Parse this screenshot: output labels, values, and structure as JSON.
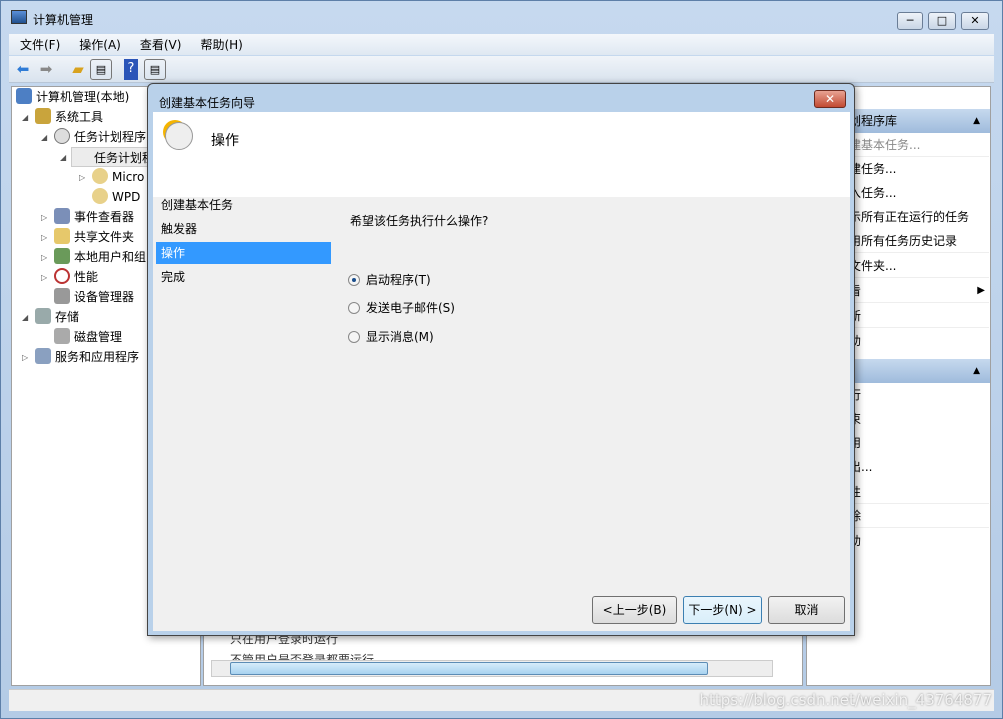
{
  "window": {
    "title": "计算机管理",
    "min": "─",
    "max": "□",
    "close": "✕"
  },
  "menu": [
    "文件(F)",
    "操作(A)",
    "查看(V)",
    "帮助(H)"
  ],
  "tree": [
    {
      "label": "计算机管理(本地)",
      "level": 0,
      "expander": ""
    },
    {
      "label": "系统工具",
      "level": 1,
      "expander": "◢"
    },
    {
      "label": "任务计划程序",
      "level": 2,
      "expander": "◢"
    },
    {
      "label": "任务计划程",
      "level": 3,
      "expander": "◢"
    },
    {
      "label": "Micro",
      "level": 4,
      "expander": "▷"
    },
    {
      "label": "WPD",
      "level": 4,
      "expander": ""
    },
    {
      "label": "事件查看器",
      "level": 2,
      "expander": "▷"
    },
    {
      "label": "共享文件夹",
      "level": 2,
      "expander": "▷"
    },
    {
      "label": "本地用户和组",
      "level": 2,
      "expander": "▷"
    },
    {
      "label": "性能",
      "level": 2,
      "expander": "▷"
    },
    {
      "label": "设备管理器",
      "level": 2,
      "expander": ""
    },
    {
      "label": "存储",
      "level": 1,
      "expander": "◢"
    },
    {
      "label": "磁盘管理",
      "level": 2,
      "expander": ""
    },
    {
      "label": "服务和应用程序",
      "level": 1,
      "expander": "▷"
    }
  ],
  "middle": {
    "radio1": "只在用户登录时运行",
    "radio2": "不管用户是否登录都要运行"
  },
  "actions": {
    "header1": "划程序库",
    "group1": [
      {
        "label": "建基本任务...",
        "disabled": true
      },
      {
        "label": "建任务..."
      },
      {
        "label": "入任务..."
      },
      {
        "label": "示所有正在运行的任务"
      },
      {
        "label": "用所有任务历史记录"
      },
      {
        "label": "文件夹..."
      },
      {
        "label": "看",
        "submenu": true
      },
      {
        "label": "新"
      },
      {
        "label": "助"
      }
    ],
    "group2": [
      {
        "label": "行"
      },
      {
        "label": "束"
      },
      {
        "label": "用"
      },
      {
        "label": "出..."
      },
      {
        "label": "性"
      },
      {
        "label": "除"
      },
      {
        "label": "助"
      }
    ]
  },
  "dialog": {
    "title": "创建基本任务向导",
    "close": "✕",
    "heading": "操作",
    "steps": [
      {
        "label": "创建基本任务"
      },
      {
        "label": "触发器"
      },
      {
        "label": "操作",
        "selected": true
      },
      {
        "label": "完成"
      }
    ],
    "question": "希望该任务执行什么操作?",
    "options": [
      {
        "label": "启动程序(T)",
        "checked": true
      },
      {
        "label": "发送电子邮件(S)"
      },
      {
        "label": "显示消息(M)"
      }
    ],
    "back": "<上一步(B)",
    "next": "下一步(N) >",
    "cancel": "取消"
  },
  "watermark": "https://blog.csdn.net/weixin_43764877"
}
